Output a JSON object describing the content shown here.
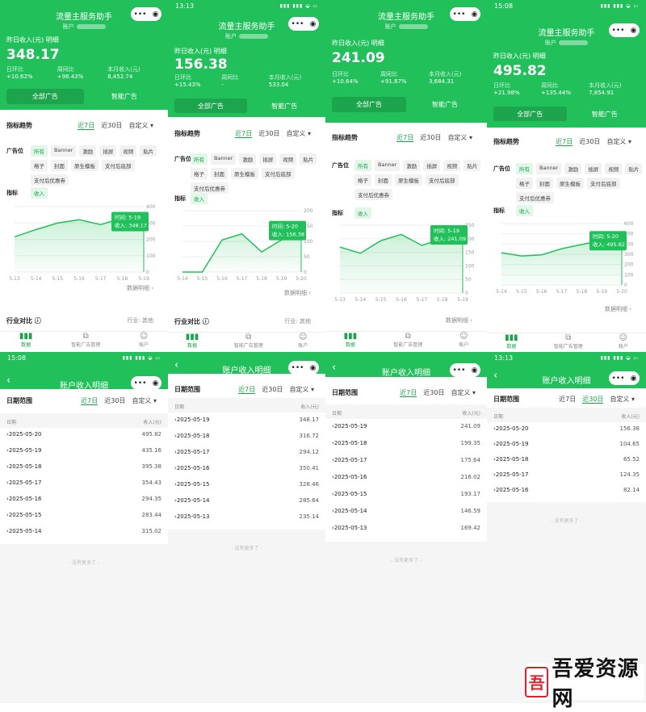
{
  "app_title": "流量主服务助手",
  "account_label": "账户",
  "yesterday_label": "昨日收入(元)",
  "detail_link": "明细",
  "dod_label": "日环比",
  "wow_label": "周同比",
  "month_label": "本月收入(元)",
  "btn_all": "全部广告",
  "btn_smart": "智能广告",
  "trend_title": "指标趋势",
  "range_7": "近7日",
  "range_30": "近30日",
  "range_custom": "自定义",
  "placement_label": "广告位",
  "placements": [
    "所有",
    "Banner",
    "激励",
    "插屏",
    "视频",
    "贴片",
    "格子",
    "封面",
    "原生模板",
    "支付后底部",
    "支付后优惠券"
  ],
  "metric_label": "指标",
  "metric_value": "收入",
  "tip_time_label": "时间",
  "tip_income_label": "收入",
  "data_detail": "数据明细",
  "industry_title": "行业对比",
  "industry_label": "行业:",
  "industry_value": "其他",
  "tabs": [
    "数据",
    "智能广告管理",
    "账户"
  ],
  "detail_title": "账户收入明细",
  "date_range_label": "日期范围",
  "col_date": "日期",
  "col_income": "收入(元)",
  "no_more": "- 没有更多了 -",
  "watermark": "吾爱资源网",
  "screens": [
    {
      "time": "",
      "yesterday": "348.17",
      "dod": "+10.62%",
      "wow": "+98.43%",
      "month": "8,452.74",
      "tip_date": "5-19",
      "tip_value": "348.17",
      "show_industry": true,
      "chart_data": {
        "type": "area",
        "x": [
          "5-13",
          "5-14",
          "5-15",
          "5-16",
          "5-17",
          "5-18",
          "5-19"
        ],
        "values": [
          215,
          260,
          300,
          320,
          290,
          330,
          348.17
        ],
        "ylim": [
          0,
          400
        ],
        "yticks": [
          0,
          100,
          200,
          300,
          400
        ]
      }
    },
    {
      "time": "13:13",
      "yesterday": "156.38",
      "dod": "+15.43%",
      "wow": "-",
      "month": "533.04",
      "tip_date": "5-20",
      "tip_value": "156.38",
      "show_industry": true,
      "chart_data": {
        "type": "area",
        "x": [
          "5-14",
          "5-15",
          "5-16",
          "5-17",
          "5-18",
          "5-19",
          "5-20"
        ],
        "values": [
          0,
          0,
          104.65,
          124.35,
          65.52,
          104.65,
          156.38
        ],
        "ylim": [
          0,
          200
        ],
        "yticks": [
          0,
          50,
          100,
          150,
          200
        ]
      }
    },
    {
      "time": "",
      "yesterday": "241.09",
      "dod": "+10.64%",
      "wow": "+91.87%",
      "month": "3,684.31",
      "tip_date": "5-19",
      "tip_value": "241.09",
      "show_industry": false,
      "chart_data": {
        "type": "area",
        "x": [
          "5-13",
          "5-14",
          "5-15",
          "5-16",
          "5-17",
          "5-18",
          "5-19"
        ],
        "values": [
          169.42,
          146.59,
          193.17,
          216.02,
          175.64,
          199.35,
          241.09
        ],
        "ylim": [
          0,
          250
        ],
        "yticks": [
          0,
          50,
          100,
          150,
          200,
          250
        ]
      }
    },
    {
      "time": "15:08",
      "yesterday": "495.82",
      "dod": "+21.98%",
      "wow": "+135.44%",
      "month": "7,854.91",
      "tip_date": "5-20",
      "tip_value": "495.82",
      "show_industry": false,
      "chart_data": {
        "type": "area",
        "x": [
          "5-14",
          "5-15",
          "5-16",
          "5-17",
          "5-18",
          "5-19",
          "5-20"
        ],
        "values": [
          315.02,
          283.44,
          294.35,
          354.43,
          395.38,
          435.16,
          495.82
        ],
        "ylim": [
          0,
          600
        ],
        "yticks": [
          0,
          100,
          200,
          300,
          400,
          500,
          600
        ]
      }
    }
  ],
  "detail_screens": [
    {
      "time": "15:08",
      "active_range": "7",
      "rows": [
        [
          "2025-05-20",
          "495.82"
        ],
        [
          "2025-05-19",
          "435.16"
        ],
        [
          "2025-05-18",
          "395.38"
        ],
        [
          "2025-05-17",
          "354.43"
        ],
        [
          "2025-05-16",
          "294.35"
        ],
        [
          "2025-05-15",
          "283.44"
        ],
        [
          "2025-05-14",
          "315.02"
        ]
      ]
    },
    {
      "time": "",
      "active_range": "7",
      "rows": [
        [
          "2025-05-19",
          "348.17"
        ],
        [
          "2025-05-18",
          "316.72"
        ],
        [
          "2025-05-17",
          "294.12"
        ],
        [
          "2025-05-16",
          "350.41"
        ],
        [
          "2025-05-15",
          "328.46"
        ],
        [
          "2025-05-14",
          "285.64"
        ],
        [
          "2025-05-13",
          "235.14"
        ]
      ]
    },
    {
      "time": "",
      "active_range": "7",
      "rows": [
        [
          "2025-05-19",
          "241.09"
        ],
        [
          "2025-05-18",
          "199.35"
        ],
        [
          "2025-05-17",
          "175.64"
        ],
        [
          "2025-05-16",
          "216.02"
        ],
        [
          "2025-05-15",
          "193.17"
        ],
        [
          "2025-05-14",
          "146.59"
        ],
        [
          "2025-05-13",
          "169.42"
        ]
      ]
    },
    {
      "time": "13:13",
      "active_range": "30",
      "rows": [
        [
          "2025-05-20",
          "156.38"
        ],
        [
          "2025-05-19",
          "104.65"
        ],
        [
          "2025-05-18",
          "65.52"
        ],
        [
          "2025-05-17",
          "124.35"
        ],
        [
          "2025-05-16",
          "82.14"
        ]
      ]
    }
  ]
}
